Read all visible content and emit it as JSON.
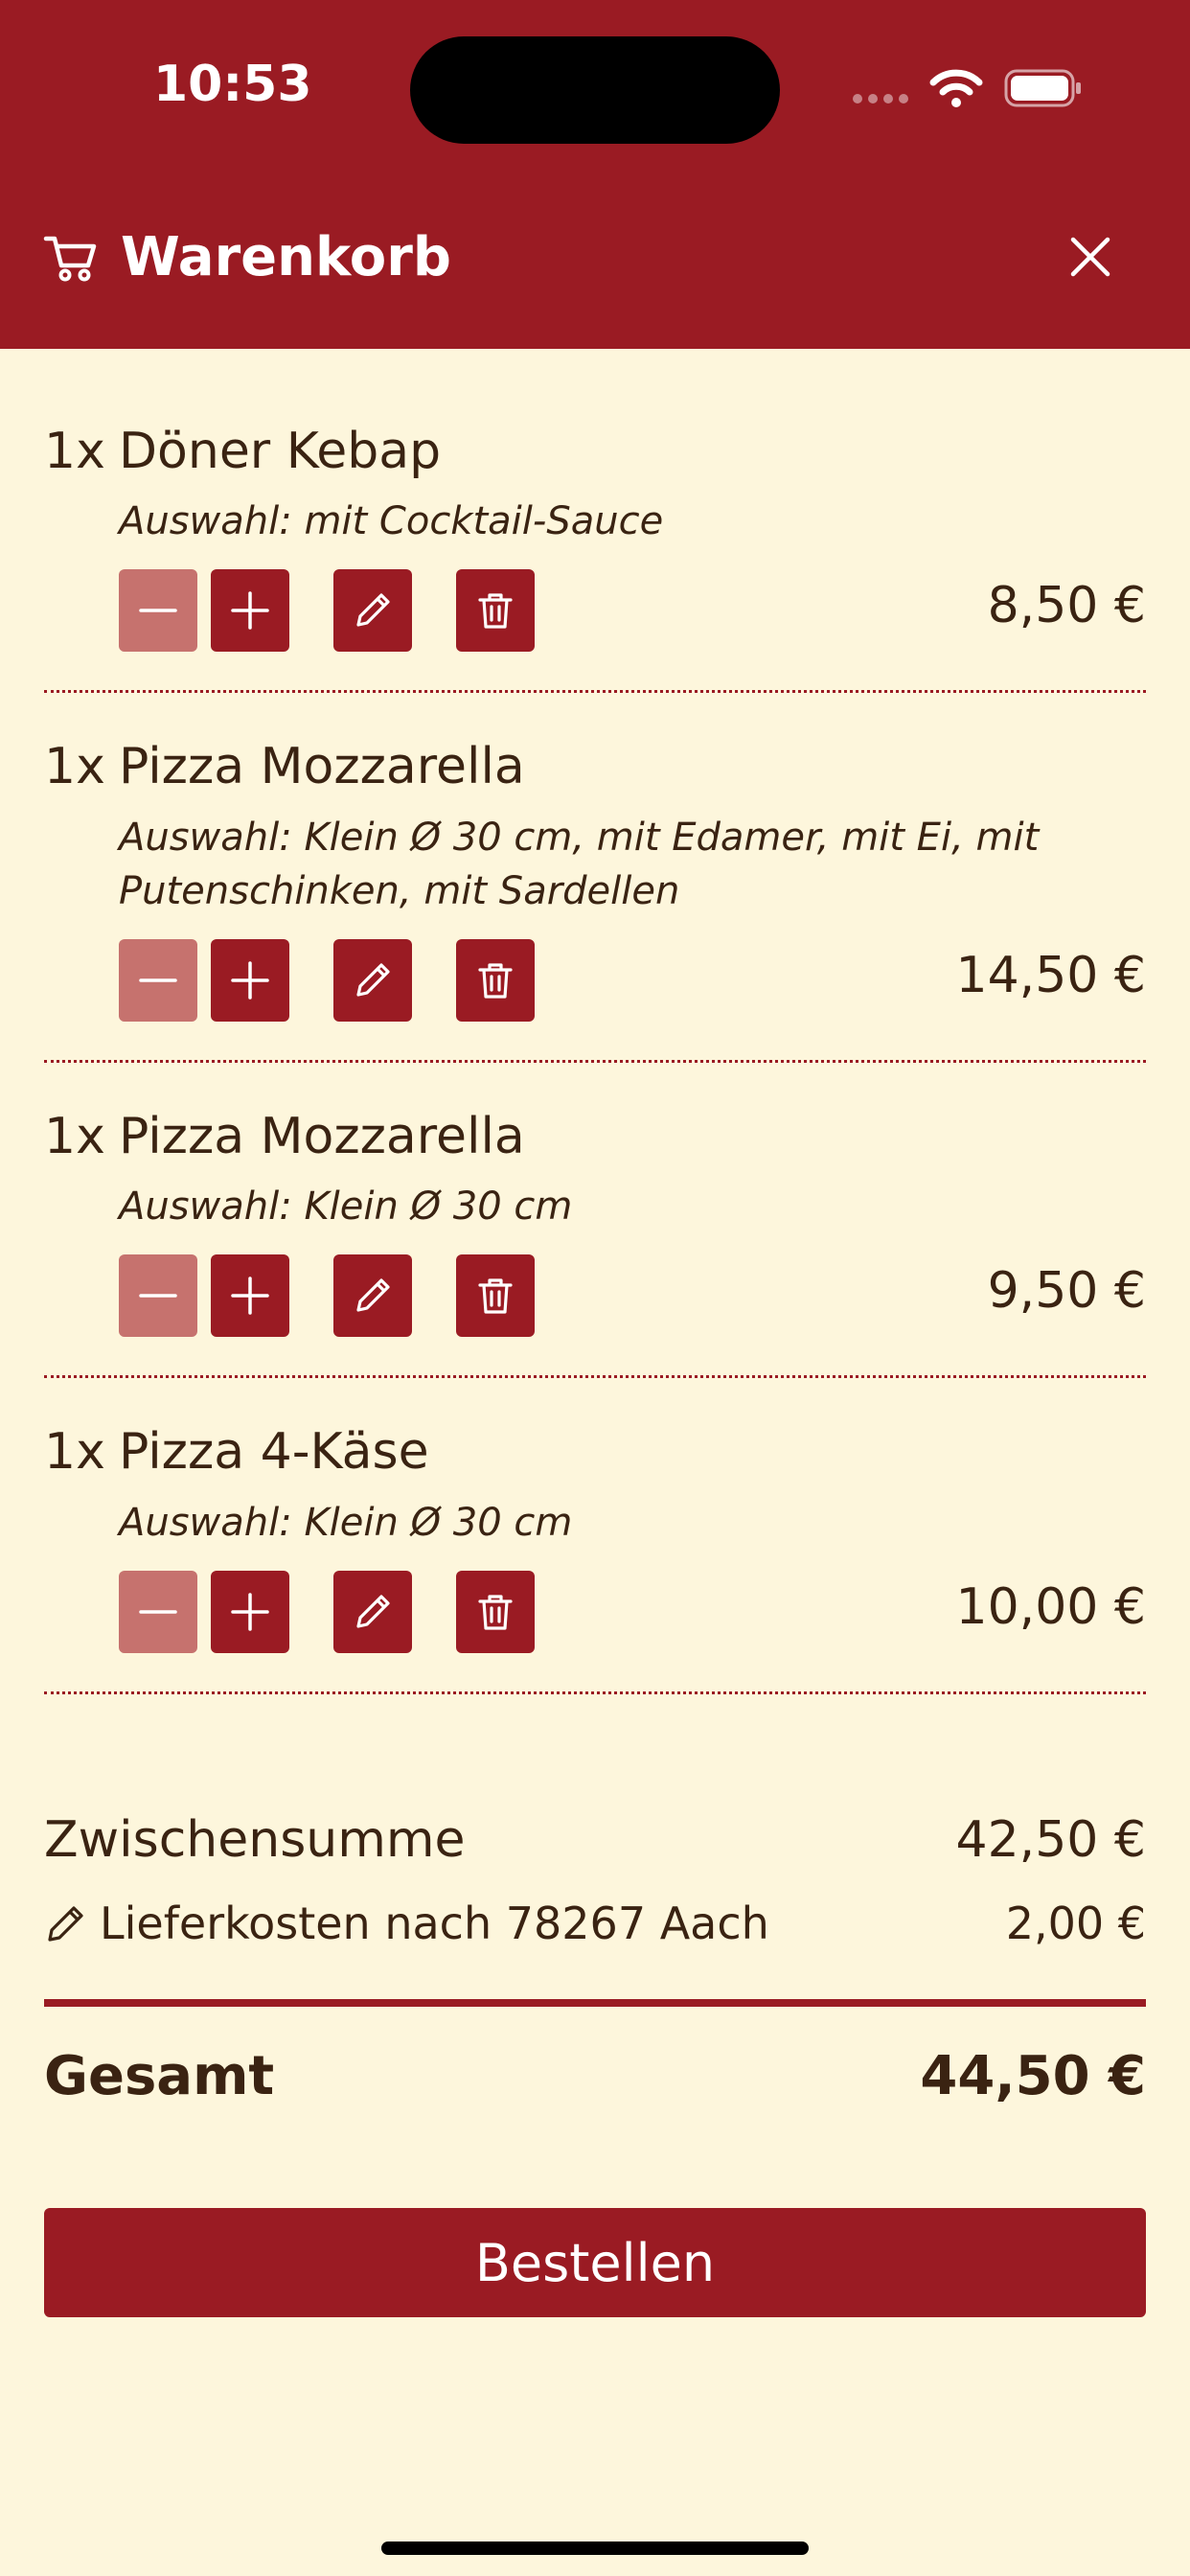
{
  "status_bar": {
    "time": "10:53"
  },
  "header": {
    "title": "Warenkorb"
  },
  "items": [
    {
      "qty": "1x",
      "name": "Döner Kebap",
      "option": "Auswahl: mit Cocktail-Sauce",
      "price": "8,50 €"
    },
    {
      "qty": "1x",
      "name": "Pizza Mozzarella",
      "option": "Auswahl: Klein Ø 30 cm, mit Edamer, mit Ei, mit Putenschinken, mit Sardellen",
      "price": "14,50 €"
    },
    {
      "qty": "1x",
      "name": "Pizza Mozzarella",
      "option": "Auswahl: Klein Ø 30 cm",
      "price": "9,50 €"
    },
    {
      "qty": "1x",
      "name": "Pizza 4-Käse",
      "option": "Auswahl: Klein Ø 30 cm",
      "price": "10,00 €"
    }
  ],
  "totals": {
    "subtotal_label": "Zwischensumme",
    "subtotal_value": "42,50 €",
    "delivery_label": "Lieferkosten nach 78267 Aach",
    "delivery_value": "2,00 €",
    "total_label": "Gesamt",
    "total_value": "44,50 €"
  },
  "order_button": {
    "label": "Bestellen"
  },
  "colors": {
    "brand": "#9A1B23",
    "background": "#FDF6DC",
    "text": "#3A2312",
    "disabled_button": "#C6726E"
  },
  "icons": {
    "header": "cart-icon",
    "close": "close-icon",
    "decrease": "minus-icon",
    "increase": "plus-icon",
    "edit": "pencil-icon",
    "delete": "trash-icon"
  }
}
